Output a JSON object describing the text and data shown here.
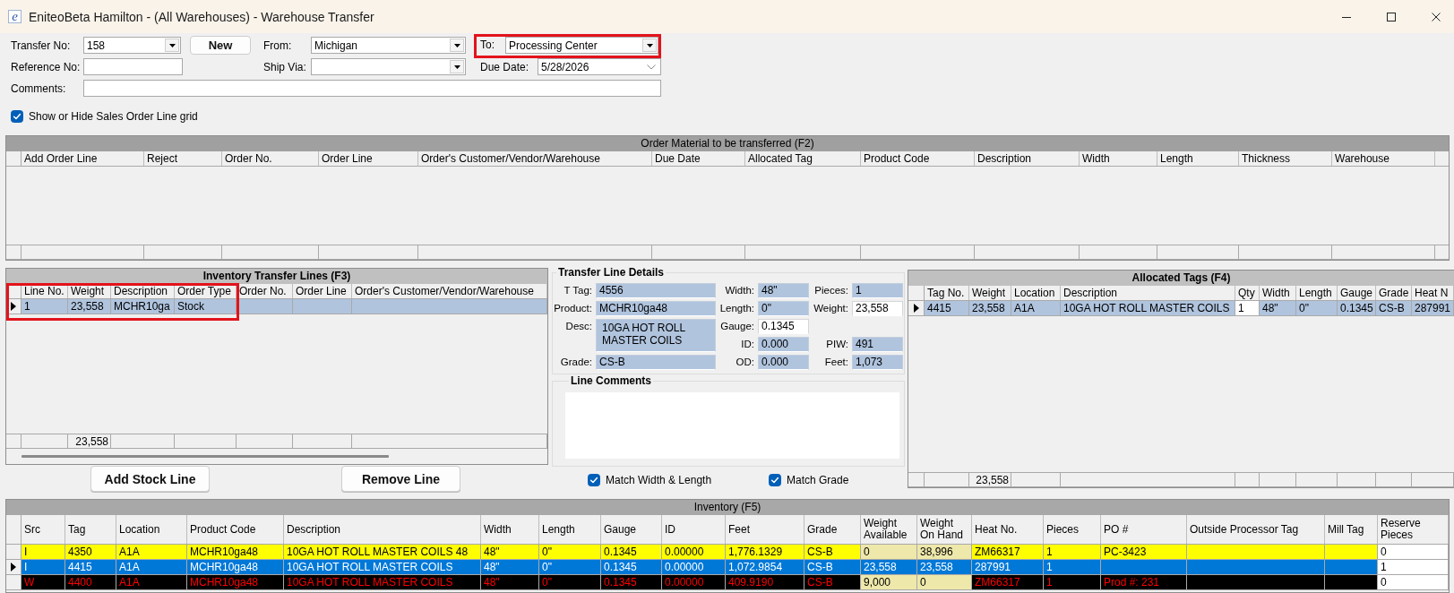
{
  "window": {
    "logo": "e",
    "title": "EniteoBeta Hamilton - (All Warehouses) - Warehouse Transfer"
  },
  "transfer_form": {
    "transfer_no": {
      "label": "Transfer No:",
      "value": "158"
    },
    "new_button": "New",
    "from": {
      "label": "From:",
      "value": "Michigan"
    },
    "to": {
      "label": "To:",
      "value": "Processing Center",
      "highlighted": true
    },
    "reference_no": {
      "label": "Reference No:"
    },
    "ship_via": {
      "label": "Ship Via:"
    },
    "due_date": {
      "label": "Due Date:",
      "value": "5/28/2026"
    },
    "comments": {
      "label": "Comments:"
    },
    "show_sales_order_grid": {
      "label": "Show or Hide Sales Order Line grid",
      "checked": true
    }
  },
  "order_material": {
    "title": "Order Material to be transferred (F2)",
    "columns": [
      "Add Order Line",
      "Reject",
      "Order No.",
      "Order Line",
      "Order's Customer/Vendor/Warehouse",
      "Due Date",
      "Allocated Tag",
      "Product Code",
      "Description",
      "Width",
      "Length",
      "Thickness",
      "Warehouse"
    ]
  },
  "transfer_lines": {
    "title": "Inventory Transfer Lines (F3)",
    "columns": [
      {
        "label": "Line No.",
        "highlighted": true
      },
      {
        "label": "Weight",
        "highlighted": true
      },
      {
        "label": "Description",
        "highlighted": true
      },
      {
        "label": "Order Type",
        "highlighted": true
      },
      {
        "label": "Order No.",
        "highlighted": false
      },
      {
        "label": "Order Line",
        "highlighted": false
      },
      {
        "label": "Order's Customer/Vendor/Warehouse",
        "highlighted": false
      }
    ],
    "rows": [
      {
        "selected": true,
        "cells": [
          "1",
          "23,558",
          "MCHR10ga",
          "Stock"
        ]
      }
    ],
    "total_weight": "23,558"
  },
  "line_details": {
    "title": "Transfer Line Details",
    "columns": [
      [
        {
          "label": "T Tag:",
          "value": "4556",
          "readonly": true
        },
        {
          "label": "Product:",
          "value": "MCHR10ga48",
          "readonly": true
        },
        {
          "label": "Desc:",
          "value": "10GA HOT ROLL MASTER COILS",
          "readonly": true
        },
        {
          "label": "Grade:",
          "value": "CS-B",
          "readonly": true
        }
      ],
      [
        {
          "label": "Width:",
          "value": "48\"",
          "readonly": true
        },
        {
          "label": "Length:",
          "value": "0\"",
          "readonly": true
        },
        {
          "label": "Gauge:",
          "value": "0.1345",
          "readonly": false
        },
        {
          "label": "ID:",
          "value": "0.000",
          "readonly": true
        },
        {
          "label": "OD:",
          "value": "0.000",
          "readonly": true
        }
      ],
      [
        {
          "label": "Pieces:",
          "value": "1",
          "readonly": true
        },
        {
          "label": "Weight:",
          "value": "23,558",
          "readonly": false
        },
        {
          "label": "PIW:",
          "value": "491",
          "readonly": true
        },
        {
          "label": "Feet:",
          "value": "1,073",
          "readonly": true
        }
      ]
    ]
  },
  "line_comments": {
    "title": "Line Comments"
  },
  "match_options": [
    {
      "label": "Match Width & Length",
      "checked": true
    },
    {
      "label": "Match Grade",
      "checked": true
    }
  ],
  "line_buttons": [
    "Add Stock Line",
    "Remove Line"
  ],
  "allocated_tags": {
    "title": "Allocated Tags (F4)",
    "columns": [
      "Tag No.",
      "Weight",
      "Location",
      "Description",
      "Qty",
      "Width",
      "Length",
      "Gauge",
      "Grade",
      "Heat N"
    ],
    "rows": [
      {
        "selected": true,
        "cells": [
          "4415",
          "23,558",
          "A1A",
          "10GA HOT ROLL MASTER COILS",
          "1",
          "48\"",
          "0\"",
          "0.1345",
          "CS-B",
          "287991"
        ]
      }
    ],
    "total_weight": "23,558"
  },
  "inventory": {
    "title": "Inventory (F5)",
    "columns": [
      "Src",
      "Tag",
      "Location",
      "Product Code",
      "Description",
      "Width",
      "Length",
      "Gauge",
      "ID",
      "Feet",
      "Grade",
      "Weight Available",
      "Weight On Hand",
      "Heat No.",
      "Pieces",
      "PO #",
      "Outside Processor Tag",
      "Mill Tag",
      "Reserve Pieces"
    ],
    "rows": [
      {
        "kind": "flagged",
        "selected": false,
        "cells": [
          "I",
          "4350",
          "A1A",
          "MCHR10ga48",
          "10GA HOT ROLL MASTER COILS 48",
          "48\"",
          "0\"",
          "0.1345",
          "0.00000",
          "1,776.1329",
          "CS-B",
          "0",
          "38,996",
          "ZM66317",
          "1",
          "PC-3423",
          null,
          null,
          "0"
        ]
      },
      {
        "kind": "normal",
        "selected": true,
        "cells": [
          "I",
          "4415",
          "A1A",
          "MCHR10ga48",
          "10GA HOT ROLL MASTER COILS",
          "48\"",
          "0\"",
          "0.1345",
          "0.00000",
          "1,072.9854",
          "CS-B",
          "23,558",
          "23,558",
          "287991",
          "1",
          null,
          null,
          null,
          "1"
        ]
      },
      {
        "kind": "alert",
        "selected": false,
        "cells": [
          "W",
          "4400",
          "A1A",
          "MCHR10ga48",
          "10GA HOT ROLL MASTER COILS",
          "48\"",
          "0\"",
          "0.1345",
          "0.00000",
          "409.9190",
          "CS-B",
          "9,000",
          "0",
          "ZM66317",
          "1",
          "Prod #: 231",
          null,
          null,
          "0"
        ]
      }
    ]
  }
}
